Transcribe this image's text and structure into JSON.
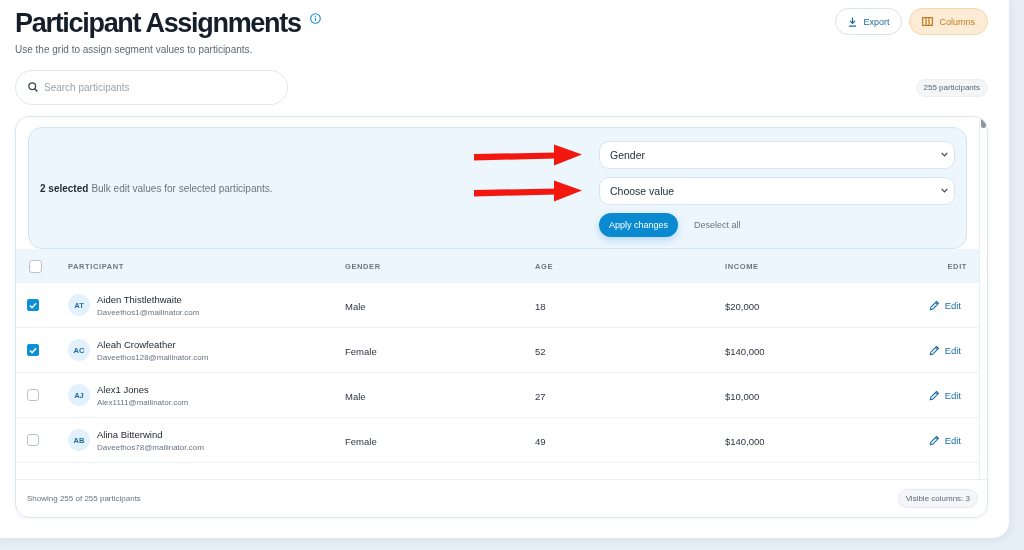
{
  "header": {
    "title": "Participant Assignments",
    "subtitle": "Use the grid to assign segment values to participants.",
    "actions": [
      {
        "kind": "export",
        "label": "Export"
      },
      {
        "kind": "columns",
        "label": "Columns"
      }
    ]
  },
  "search": {
    "placeholder": "Search participants"
  },
  "participant_count": "255 participants",
  "bulk_edit": {
    "count": "2 selected",
    "hint": "Bulk edit values for selected participants.",
    "selects": [
      {
        "value": "Gender",
        "arrow_marker": true
      },
      {
        "value": "Choose value",
        "arrow_marker": true
      }
    ],
    "apply_button": "Apply changes",
    "deselect_button": "Deselect all"
  },
  "table": {
    "select_all": {
      "checked": false
    },
    "columns": [
      "PARTICIPANT",
      "GENDER",
      "AGE",
      "INCOME",
      "EDIT"
    ],
    "rows": [
      {
        "checked": true,
        "initials": "AT",
        "name": "Aiden Thistlethwaite",
        "email": "Daveethos1@mailinator.com",
        "gender": "Male",
        "age": "18",
        "income": "$20,000",
        "action": "Edit"
      },
      {
        "checked": true,
        "initials": "AC",
        "name": "Aleah Crowfeather",
        "email": "Daveethos128@mailinator.com",
        "gender": "Female",
        "age": "52",
        "income": "$140,000",
        "action": "Edit"
      },
      {
        "checked": false,
        "initials": "AJ",
        "name": "Alex1 Jones",
        "email": "Alex1111@mailinator.com",
        "gender": "Male",
        "age": "27",
        "income": "$10,000",
        "action": "Edit"
      },
      {
        "checked": false,
        "initials": "AB",
        "name": "Alina Bitterwind",
        "email": "Daveethos78@mailinator.com",
        "gender": "Female",
        "age": "49",
        "income": "$140,000",
        "action": "Edit"
      }
    ]
  },
  "footer": {
    "summary": "Showing 255 of 255 participants",
    "visible_columns": "Visible columns: 3"
  }
}
